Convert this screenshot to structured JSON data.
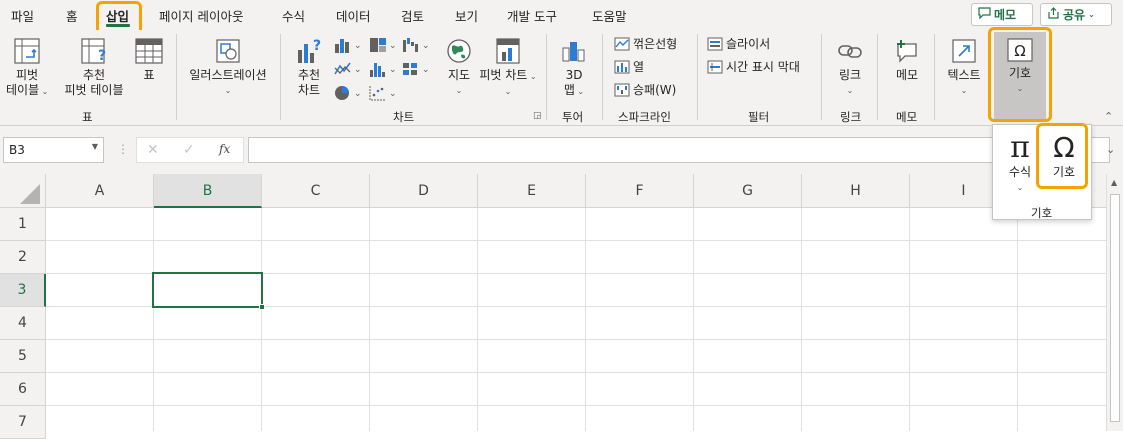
{
  "tabs": [
    "파일",
    "홈",
    "삽입",
    "페이지 레이아웃",
    "수식",
    "데이터",
    "검토",
    "보기",
    "개발 도구",
    "도움말"
  ],
  "top_buttons": {
    "memo": "메모",
    "share": "공유"
  },
  "ribbon": {
    "pivot_table": [
      "피벗",
      "테이블"
    ],
    "recommended_pivot": [
      "추천",
      "피벗 테이블"
    ],
    "table": "표",
    "illustrations": "일러스트레이션",
    "recommended_charts": [
      "추천",
      "차트"
    ],
    "maps": "지도",
    "pivot_chart": "피벗 차트",
    "map3d": [
      "3D",
      "맵"
    ],
    "sparkline_line": "꺾은선형",
    "sparkline_column": "열",
    "sparkline_winloss": "승패(W)",
    "slicer": "슬라이서",
    "timeline": "시간 표시 막대",
    "link": "링크",
    "comment": "메모",
    "text": "텍스트",
    "symbols": "기호",
    "group_labels": {
      "tables": "표",
      "charts": "차트",
      "tours": "투어",
      "sparklines": "스파크라인",
      "filters": "필터",
      "links": "링크",
      "comments": "메모"
    }
  },
  "formula_bar": {
    "name_box": "B3",
    "fx": "fx",
    "formula": ""
  },
  "dropdown": {
    "equation": "수식",
    "symbol": "기호",
    "group_label": "기호"
  },
  "grid": {
    "columns": [
      "A",
      "B",
      "C",
      "D",
      "E",
      "F",
      "G",
      "H",
      "I"
    ],
    "rows": [
      "1",
      "2",
      "3",
      "4",
      "5",
      "6",
      "7"
    ],
    "selected_col": "B",
    "selected_row": "3"
  },
  "colors": {
    "accent": "#217346",
    "highlight": "#f5a300",
    "ribbon_bg": "#f3f2f1"
  }
}
